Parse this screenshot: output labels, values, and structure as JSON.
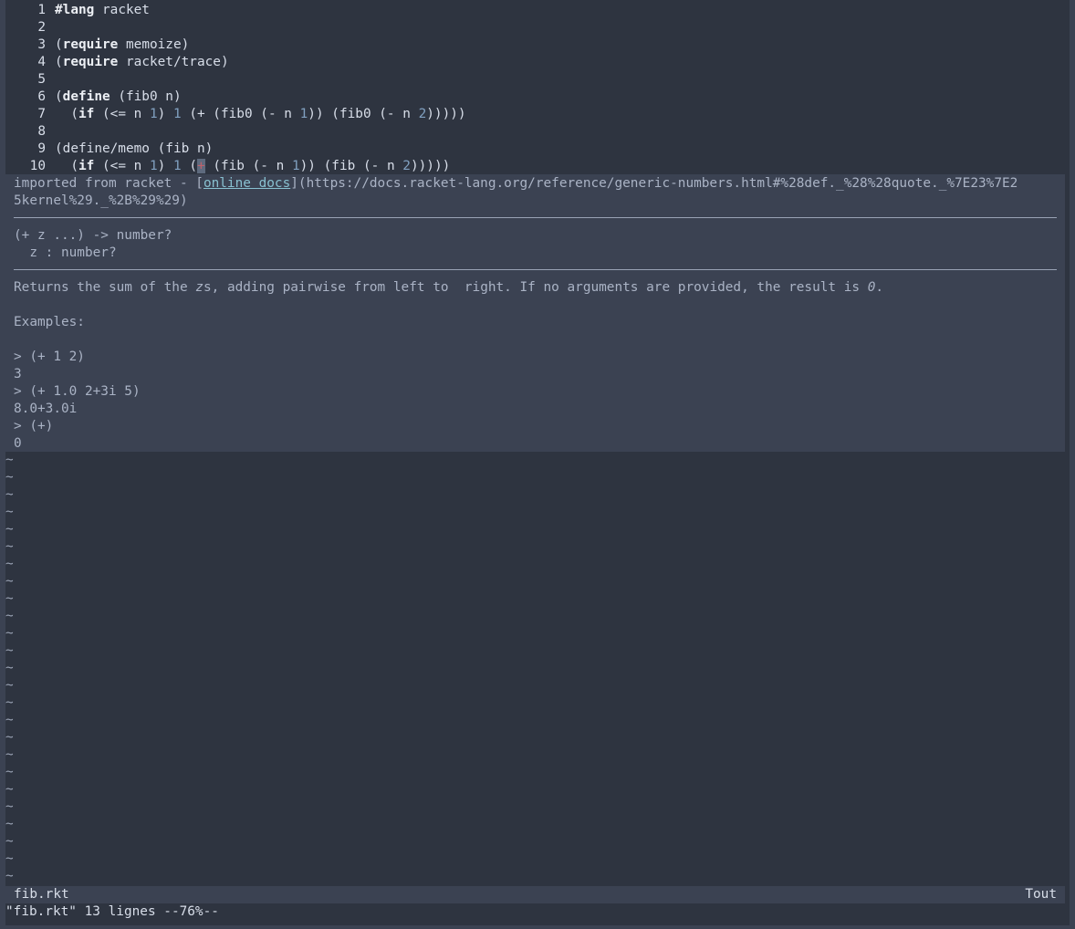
{
  "editor": {
    "lines": [
      {
        "n": "1"
      },
      {
        "n": "2"
      },
      {
        "n": "3"
      },
      {
        "n": "4"
      },
      {
        "n": "5"
      },
      {
        "n": "6"
      },
      {
        "n": "7"
      },
      {
        "n": "8"
      },
      {
        "n": "9"
      },
      {
        "n": "10"
      }
    ],
    "code": {
      "l1_kw": "#lang",
      "l1_rest": " racket",
      "l3_open": "(",
      "l3_kw": "require",
      "l3_rest": " memoize)",
      "l4_open": "(",
      "l4_kw": "require",
      "l4_rest": " racket/trace)",
      "l6_open": "(",
      "l6_kw": "define",
      "l6_rest": " (fib0 n)",
      "l7_a": "  (",
      "l7_kw": "if",
      "l7_b": " (<= n ",
      "l7_n1": "1",
      "l7_c": ") ",
      "l7_n2": "1",
      "l7_d": " (+ (fib0 (- n ",
      "l7_n3": "1",
      "l7_e": ")) (fib0 (- n ",
      "l7_n4": "2",
      "l7_f": ")))))",
      "l9": "(define/memo (fib n)",
      "l10_a": "  (",
      "l10_kw": "if",
      "l10_b": " (<= n ",
      "l10_n1": "1",
      "l10_c": ") ",
      "l10_n2": "1",
      "l10_d": " (",
      "l10_cur": "+",
      "l10_e": " (fib (- n ",
      "l10_n3": "1",
      "l10_f": ")) (fib (- n ",
      "l10_n4": "2",
      "l10_g": ")))))"
    }
  },
  "popup": {
    "imported_prefix": "imported from racket - [",
    "link_text": "online docs",
    "url_line1": "](https://docs.racket-lang.org/reference/generic-numbers.html#%28def._%28%28quote._%7E23%7E2",
    "url_line2": "5kernel%29._%2B%29%29)",
    "sig_line1": "(+ z ...) -> number?",
    "sig_line2": "  z : number?",
    "desc_a": "Returns the sum of the ",
    "desc_em": "z",
    "desc_b": "s, adding pairwise from left to  right. If no arguments are provided, the result is ",
    "desc_zero": "0",
    "desc_c": ".",
    "examples_label": "Examples:",
    "examples": [
      "> (+ 1 2)",
      "3",
      "> (+ 1.0 2+3i 5)",
      "8.0+3.0i",
      "> (+)",
      "0"
    ]
  },
  "tilde_glyph": "~",
  "status": {
    "filename": "fib.rkt",
    "position": "Tout"
  },
  "cmdline": "\"fib.rkt\" 13 lignes --76%--"
}
